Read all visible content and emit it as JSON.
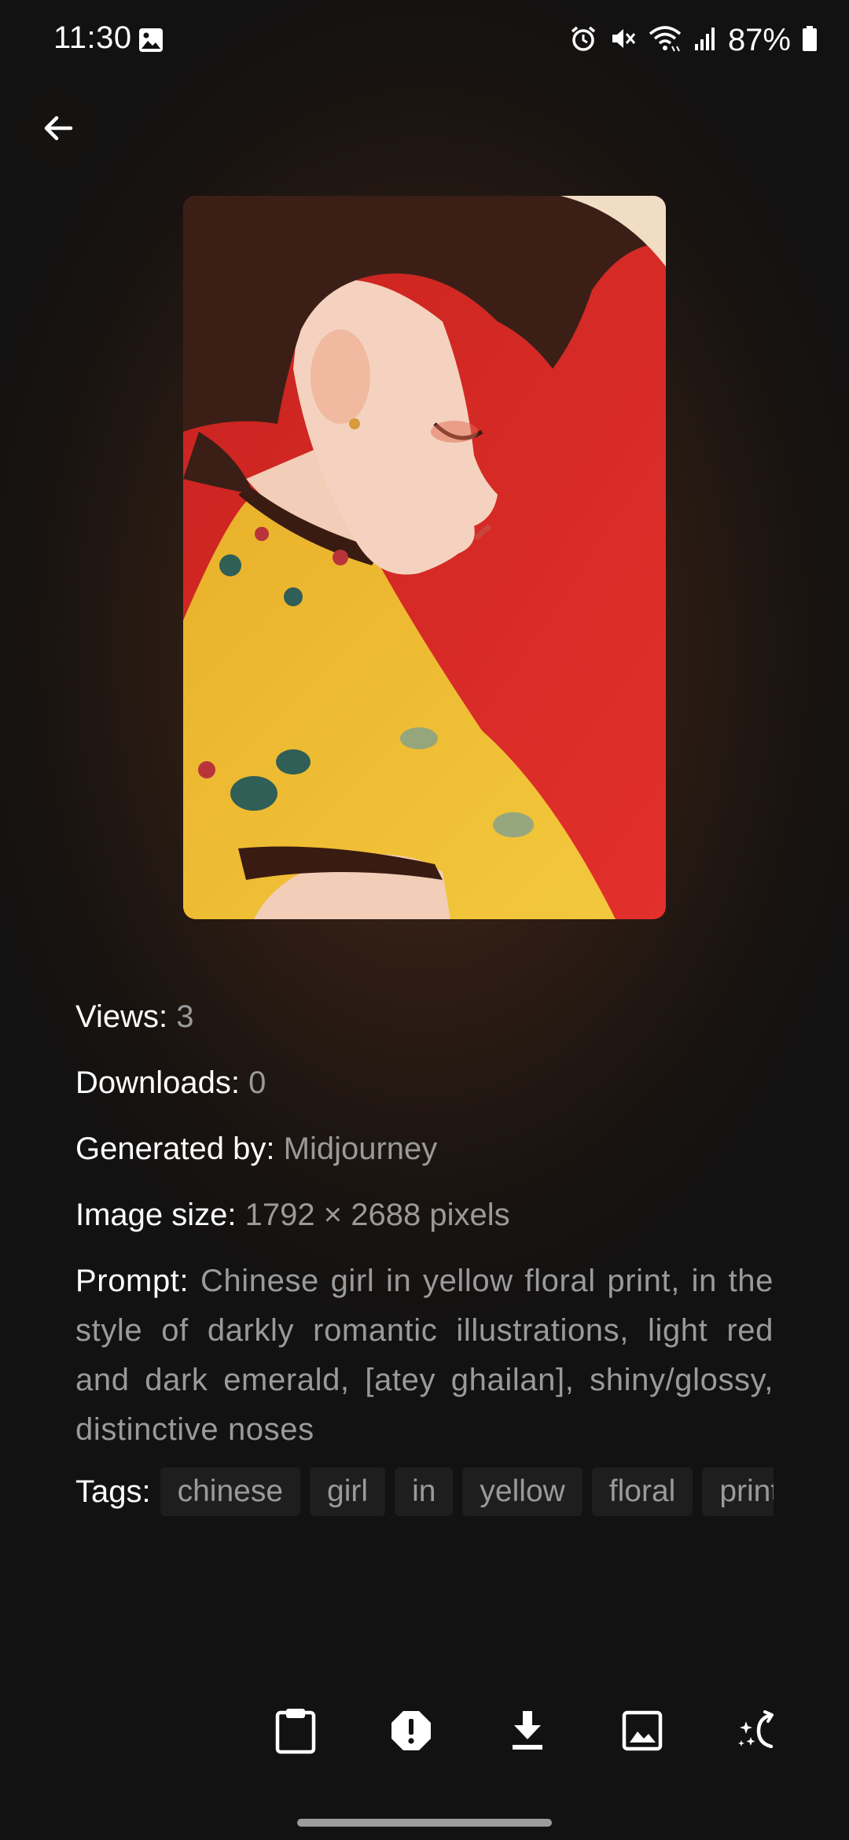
{
  "status_bar": {
    "time": "11:30",
    "battery": "87%",
    "icons": [
      "gallery-icon",
      "alarm-icon",
      "mute-icon",
      "wifi-icon",
      "signal-icon",
      "battery-icon"
    ]
  },
  "navigation": {
    "back_icon": "arrow-left-icon"
  },
  "details": {
    "views_label": "Views:",
    "views_value": "3",
    "downloads_label": "Downloads:",
    "downloads_value": "0",
    "generated_label": "Generated by:",
    "generated_value": "Midjourney",
    "size_label": "Image size:",
    "size_value": "1792 × 2688 pixels",
    "prompt_label": "Prompt:",
    "prompt_value": "Chinese girl in yellow floral print, in the style of darkly romantic illustrations, light red and dark emerald, [atey ghailan], shiny/glossy, distinctive noses",
    "tags_label": "Tags:",
    "tags": [
      "chinese",
      "girl",
      "in",
      "yellow",
      "floral",
      "print"
    ]
  },
  "actions": [
    "clipboard-icon",
    "report-icon",
    "download-icon",
    "set-wallpaper-icon",
    "remix-icon"
  ],
  "colors": {
    "background": "#121212",
    "glow": "#4a2c1b",
    "label": "#ffffff",
    "value": "#9a9a9a",
    "tag_bg": "#1e1e1e",
    "art_red": "#e0282a",
    "art_yellow": "#f2c232"
  }
}
